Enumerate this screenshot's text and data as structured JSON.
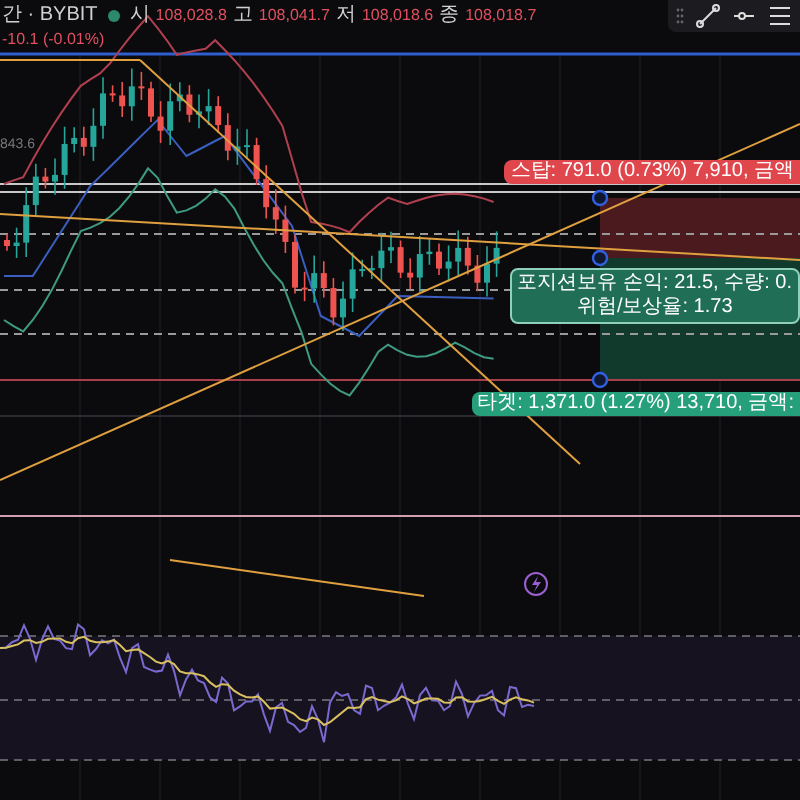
{
  "header": {
    "symbol": "간 · BYBIT",
    "ohlc": [
      {
        "key": "시",
        "value": "108,028.8"
      },
      {
        "key": "고",
        "value": "108,041.7"
      },
      {
        "key": "저",
        "value": "108,018.6"
      },
      {
        "key": "종",
        "value": "108,018.7"
      }
    ],
    "change": "-10.1 (-0.01%)"
  },
  "chart": {
    "price_label": "843.6",
    "stop_label": "스탑: 791.0 (0.73%) 7,910, 금액",
    "position_label": [
      "포지션보유 손익: 21.5, 수량: 0.",
      "위험/보상율: 1.73"
    ],
    "target_label": "타겟: 1,371.0 (1.27%) 13,710, 금액:"
  }
}
